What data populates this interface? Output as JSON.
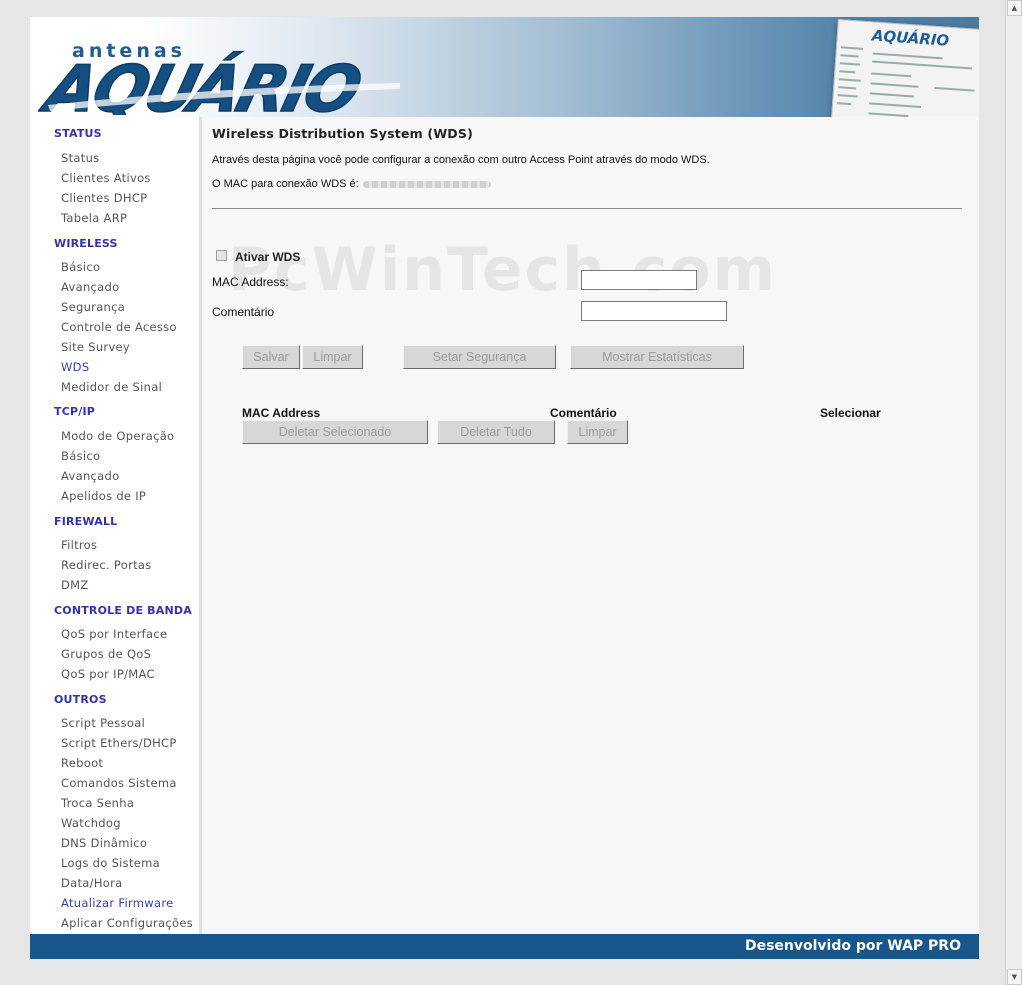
{
  "header": {
    "logo_small": "antenas",
    "logo_big": "AQUÁRIO",
    "preview_logo": "AQUÁRIO"
  },
  "sidebar": {
    "sections": [
      {
        "title": "STATUS",
        "items": [
          "Status",
          "Clientes Ativos",
          "Clientes DHCP",
          "Tabela ARP"
        ]
      },
      {
        "title": "WIRELESS",
        "items": [
          "Básico",
          "Avançado",
          "Segurança",
          "Controle de Acesso",
          "Site Survey",
          "WDS",
          "Medidor de Sinal"
        ]
      },
      {
        "title": "TCP/IP",
        "items": [
          "Modo de Operação",
          "Básico",
          "Avançado",
          "Apelidos de IP"
        ]
      },
      {
        "title": "FIREWALL",
        "items": [
          "Filtros",
          "Redirec. Portas",
          "DMZ"
        ]
      },
      {
        "title": "CONTROLE DE BANDA",
        "items": [
          "QoS por Interface",
          "Grupos de QoS",
          "QoS por IP/MAC"
        ]
      },
      {
        "title": "OUTROS",
        "items": [
          "Script Pessoal",
          "Script Ethers/DHCP",
          "Reboot",
          "Comandos Sistema",
          "Troca Senha",
          "Watchdog",
          "DNS Dinâmico",
          "Logs do Sistema",
          "Data/Hora",
          "Atualizar Firmware",
          "Aplicar Configurações"
        ]
      }
    ],
    "colors": {
      "section": "#3333aa",
      "item": "#555555",
      "active": "#3344aa"
    }
  },
  "content": {
    "title": "Wireless Distribution System (WDS)",
    "description": "Através desta página você pode configurar a conexão com outro Access Point através do modo WDS.",
    "mac_label": "O MAC para conexão WDS é:",
    "watermark": "PcWinTech.com",
    "enable_label": "Ativar WDS",
    "mac_field_label": "MAC Address:",
    "mac_field_value": "",
    "comment_field_label": "Comentário",
    "comment_field_value": "",
    "buttons": {
      "save": "Salvar",
      "clear": "Limpar",
      "security": "Setar Segurança",
      "stats": "Mostrar Estatísticas",
      "delete_selected": "Deletar Selecionado",
      "delete_all": "Deletar Tudo",
      "clear2": "Limpar"
    },
    "table_headers": [
      "MAC Address",
      "Comentário",
      "Selecionar"
    ]
  },
  "footer": {
    "text": "Desenvolvido por WAP PRO",
    "color": "#17578c"
  }
}
